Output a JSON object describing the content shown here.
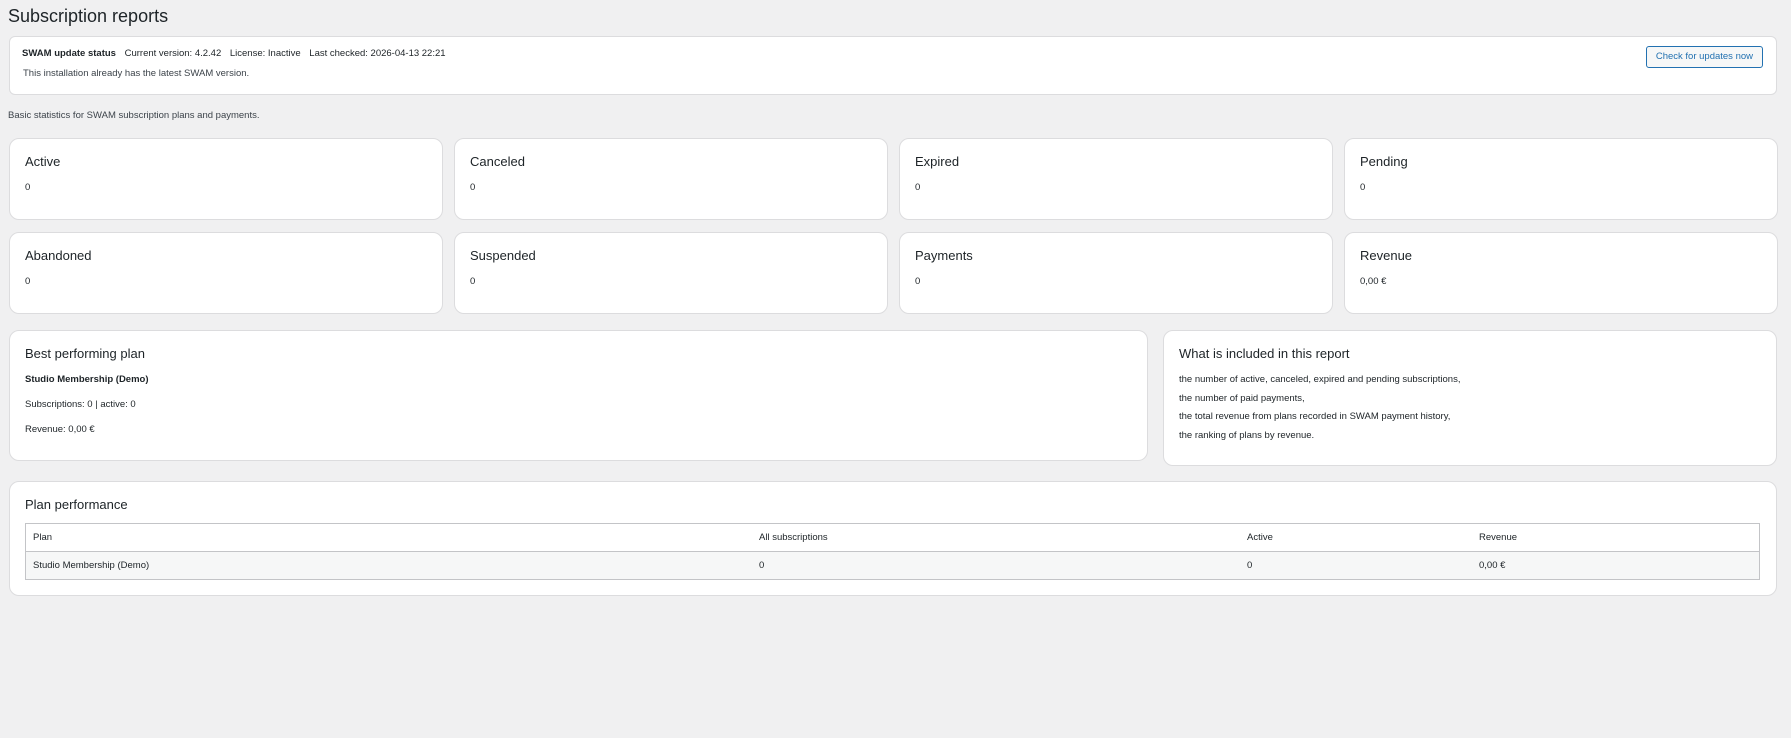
{
  "page": {
    "title": "Subscription reports"
  },
  "update": {
    "label": "SWAM update status",
    "current_version": "Current version: 4.2.42",
    "license": "License: Inactive",
    "last_checked": "Last checked: 2026-04-13 22:21",
    "message": "This installation already has the latest SWAM version.",
    "button": "Check for updates now"
  },
  "intro": "Basic statistics for SWAM subscription plans and payments.",
  "stats": [
    {
      "label": "Active",
      "value": "0"
    },
    {
      "label": "Canceled",
      "value": "0"
    },
    {
      "label": "Expired",
      "value": "0"
    },
    {
      "label": "Pending",
      "value": "0"
    },
    {
      "label": "Abandoned",
      "value": "0"
    },
    {
      "label": "Suspended",
      "value": "0"
    },
    {
      "label": "Payments",
      "value": "0"
    },
    {
      "label": "Revenue",
      "value": "0,00 €"
    }
  ],
  "best": {
    "title": "Best performing plan",
    "plan": "Studio Membership (Demo)",
    "subscriptions": "Subscriptions: 0 | active: 0",
    "revenue": "Revenue: 0,00 €"
  },
  "include": {
    "title": "What is included in this report",
    "items": [
      "the number of active, canceled, expired and pending subscriptions,",
      "the number of paid payments,",
      "the total revenue from plans recorded in SWAM payment history,",
      "the ranking of plans by revenue."
    ]
  },
  "performance": {
    "title": "Plan performance",
    "headers": [
      "Plan",
      "All subscriptions",
      "Active",
      "Revenue"
    ],
    "rows": [
      [
        "Studio Membership (Demo)",
        "0",
        "0",
        "0,00 €"
      ]
    ]
  }
}
